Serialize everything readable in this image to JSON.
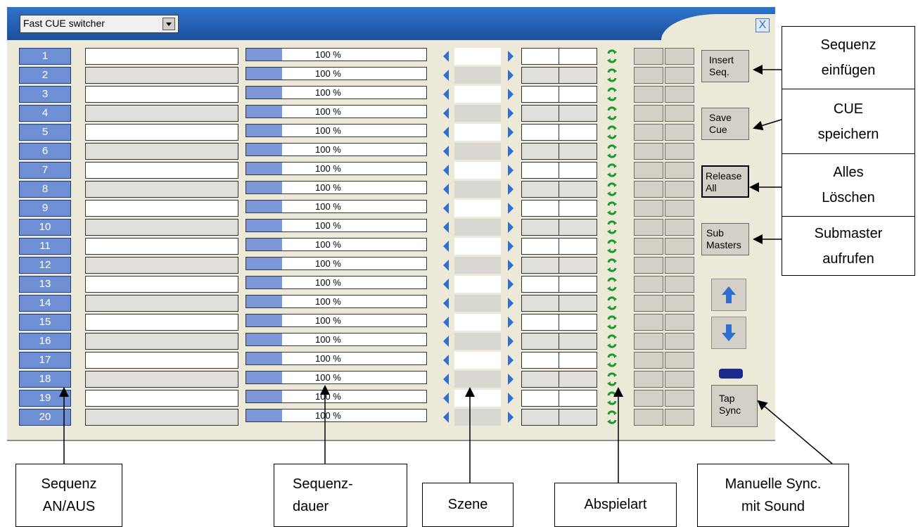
{
  "window": {
    "title_combo": "Fast CUE switcher",
    "close_glyph": "X"
  },
  "rows": [
    {
      "num": "1",
      "percent": "100 %",
      "fill": 0.2
    },
    {
      "num": "2",
      "percent": "100 %",
      "fill": 0.2
    },
    {
      "num": "3",
      "percent": "100 %",
      "fill": 0.2
    },
    {
      "num": "4",
      "percent": "100 %",
      "fill": 0.2
    },
    {
      "num": "5",
      "percent": "100 %",
      "fill": 0.2
    },
    {
      "num": "6",
      "percent": "100 %",
      "fill": 0.2
    },
    {
      "num": "7",
      "percent": "100 %",
      "fill": 0.2
    },
    {
      "num": "8",
      "percent": "100 %",
      "fill": 0.2
    },
    {
      "num": "9",
      "percent": "100 %",
      "fill": 0.2
    },
    {
      "num": "10",
      "percent": "100 %",
      "fill": 0.2
    },
    {
      "num": "11",
      "percent": "100 %",
      "fill": 0.2
    },
    {
      "num": "12",
      "percent": "100 %",
      "fill": 0.2
    },
    {
      "num": "13",
      "percent": "100 %",
      "fill": 0.2
    },
    {
      "num": "14",
      "percent": "100 %",
      "fill": 0.2
    },
    {
      "num": "15",
      "percent": "100 %",
      "fill": 0.2
    },
    {
      "num": "16",
      "percent": "100 %",
      "fill": 0.2
    },
    {
      "num": "17",
      "percent": "100 %",
      "fill": 0.2
    },
    {
      "num": "18",
      "percent": "100 %",
      "fill": 0.2
    },
    {
      "num": "19",
      "percent": "100 %",
      "fill": 0.2
    },
    {
      "num": "20",
      "percent": "100 %",
      "fill": 0.2
    }
  ],
  "side_buttons": {
    "insert_seq": [
      "Insert",
      "Seq."
    ],
    "save_cue": [
      "Save",
      "Cue"
    ],
    "release_all": [
      "Release",
      "All"
    ],
    "sub_masters": [
      "Sub",
      "Masters"
    ],
    "tap_sync": [
      "Tap",
      "Sync"
    ]
  },
  "icons": {
    "up": "up-arrow-icon",
    "down": "down-arrow-icon",
    "loop": "loop-icon"
  },
  "callouts": {
    "sequenz_einfuegen": [
      "Sequenz",
      "einfügen"
    ],
    "cue_speichern": [
      "CUE",
      "speichern"
    ],
    "alles_loeschen": [
      "Alles",
      "Löschen"
    ],
    "submaster_aufrufen": [
      "Submaster",
      "aufrufen"
    ],
    "sequenz_an_aus": [
      "Sequenz",
      "AN/AUS"
    ],
    "sequenz_dauer": [
      "Sequenz-",
      "dauer"
    ],
    "szene": [
      "Szene"
    ],
    "abspielart": [
      "Abspielart"
    ],
    "manuelle_sync": [
      "Manuelle Sync.",
      "mit Sound"
    ]
  },
  "colors": {
    "title_bar": "#2f74cc",
    "button_blue": "#6f8fd4",
    "loop_green": "#1a9a2c",
    "nav_arrow": "#2f6fd0",
    "gray_bg": "#ece9d8",
    "indicator": "#1c2a8c"
  }
}
